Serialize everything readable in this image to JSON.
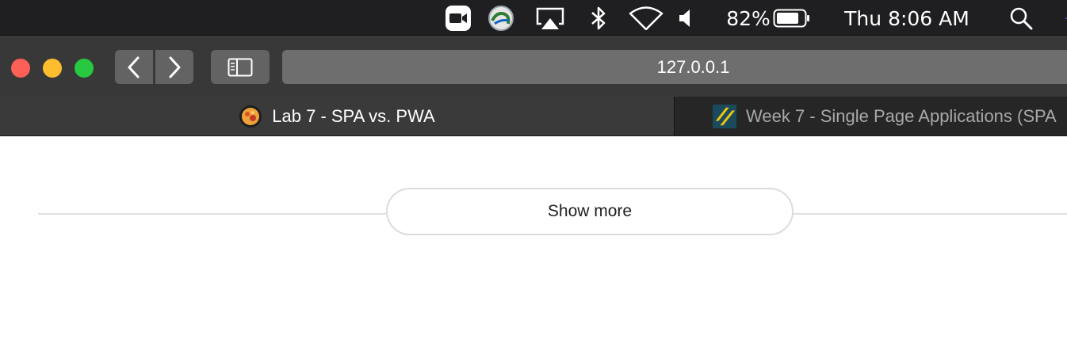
{
  "menubar": {
    "battery_percent": "82%",
    "clock": "Thu 8:06 AM",
    "icons": [
      "zoom-video-icon",
      "globe-app-icon",
      "airplay-icon",
      "bluetooth-icon",
      "wifi-icon",
      "volume-icon",
      "battery-icon",
      "spotlight-search-icon",
      "siri-icon"
    ],
    "battery_level": 0.82
  },
  "toolbar": {
    "url": "127.0.0.1",
    "icons": [
      "back-icon",
      "forward-icon",
      "sidebar-icon"
    ]
  },
  "tabs": [
    {
      "label": "Lab 7 - SPA vs. PWA",
      "active": true
    },
    {
      "label": "Week 7 - Single Page Applications (SPA",
      "active": false
    }
  ],
  "page": {
    "show_more_label": "Show more"
  },
  "colors": {
    "close": "#fe5f57",
    "minimize": "#febc2e",
    "zoom": "#28c840"
  }
}
